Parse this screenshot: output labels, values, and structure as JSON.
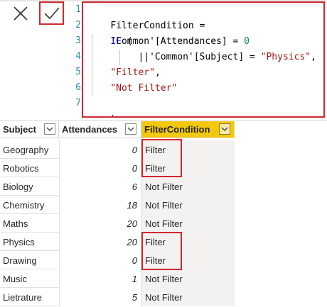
{
  "formula_bar": {
    "cancel_icon": "close-icon",
    "commit_icon": "checkmark-icon",
    "line_numbers": [
      "1",
      "2",
      "3",
      "4",
      "5",
      "6",
      "7"
    ],
    "code": {
      "l1": "FilterCondition =",
      "l2_kw": "IF",
      "l2_rest": " (",
      "l3_tbl": "'Common'[Attendances]",
      "l3_op": " = ",
      "l3_num": "0",
      "l4_op": "||",
      "l4_tbl": "'Common'[Subject]",
      "l4_eq": " = ",
      "l4_str": "\"Physics\"",
      "l4_comma": ",",
      "l5_str": "\"Filter\"",
      "l5_comma": ",",
      "l6_str": "\"Not Filter\"",
      "l7": ")"
    }
  },
  "table": {
    "columns": [
      "Subject",
      "Attendances",
      "FilterCondition"
    ],
    "dropdown_icon": "chevron-down-icon",
    "rows": [
      {
        "subject": "Geography",
        "attendances": "0",
        "filter": "Filter"
      },
      {
        "subject": "Robotics",
        "attendances": "0",
        "filter": "Filter"
      },
      {
        "subject": "Biology",
        "attendances": "6",
        "filter": "Not Filter"
      },
      {
        "subject": "Chemistry",
        "attendances": "18",
        "filter": "Not Filter"
      },
      {
        "subject": "Maths",
        "attendances": "20",
        "filter": "Not Filter"
      },
      {
        "subject": "Physics",
        "attendances": "20",
        "filter": "Filter"
      },
      {
        "subject": "Drawing",
        "attendances": "0",
        "filter": "Filter"
      },
      {
        "subject": "Music",
        "attendances": "1",
        "filter": "Not Filter"
      },
      {
        "subject": "Lietrature",
        "attendances": "5",
        "filter": "Not Filter"
      }
    ]
  },
  "colors": {
    "highlight_border": "#d22630",
    "active_header": "#f2c811",
    "keyword": "#0000ff",
    "string": "#a31515",
    "number": "#098658",
    "line_number": "#2b91af"
  }
}
